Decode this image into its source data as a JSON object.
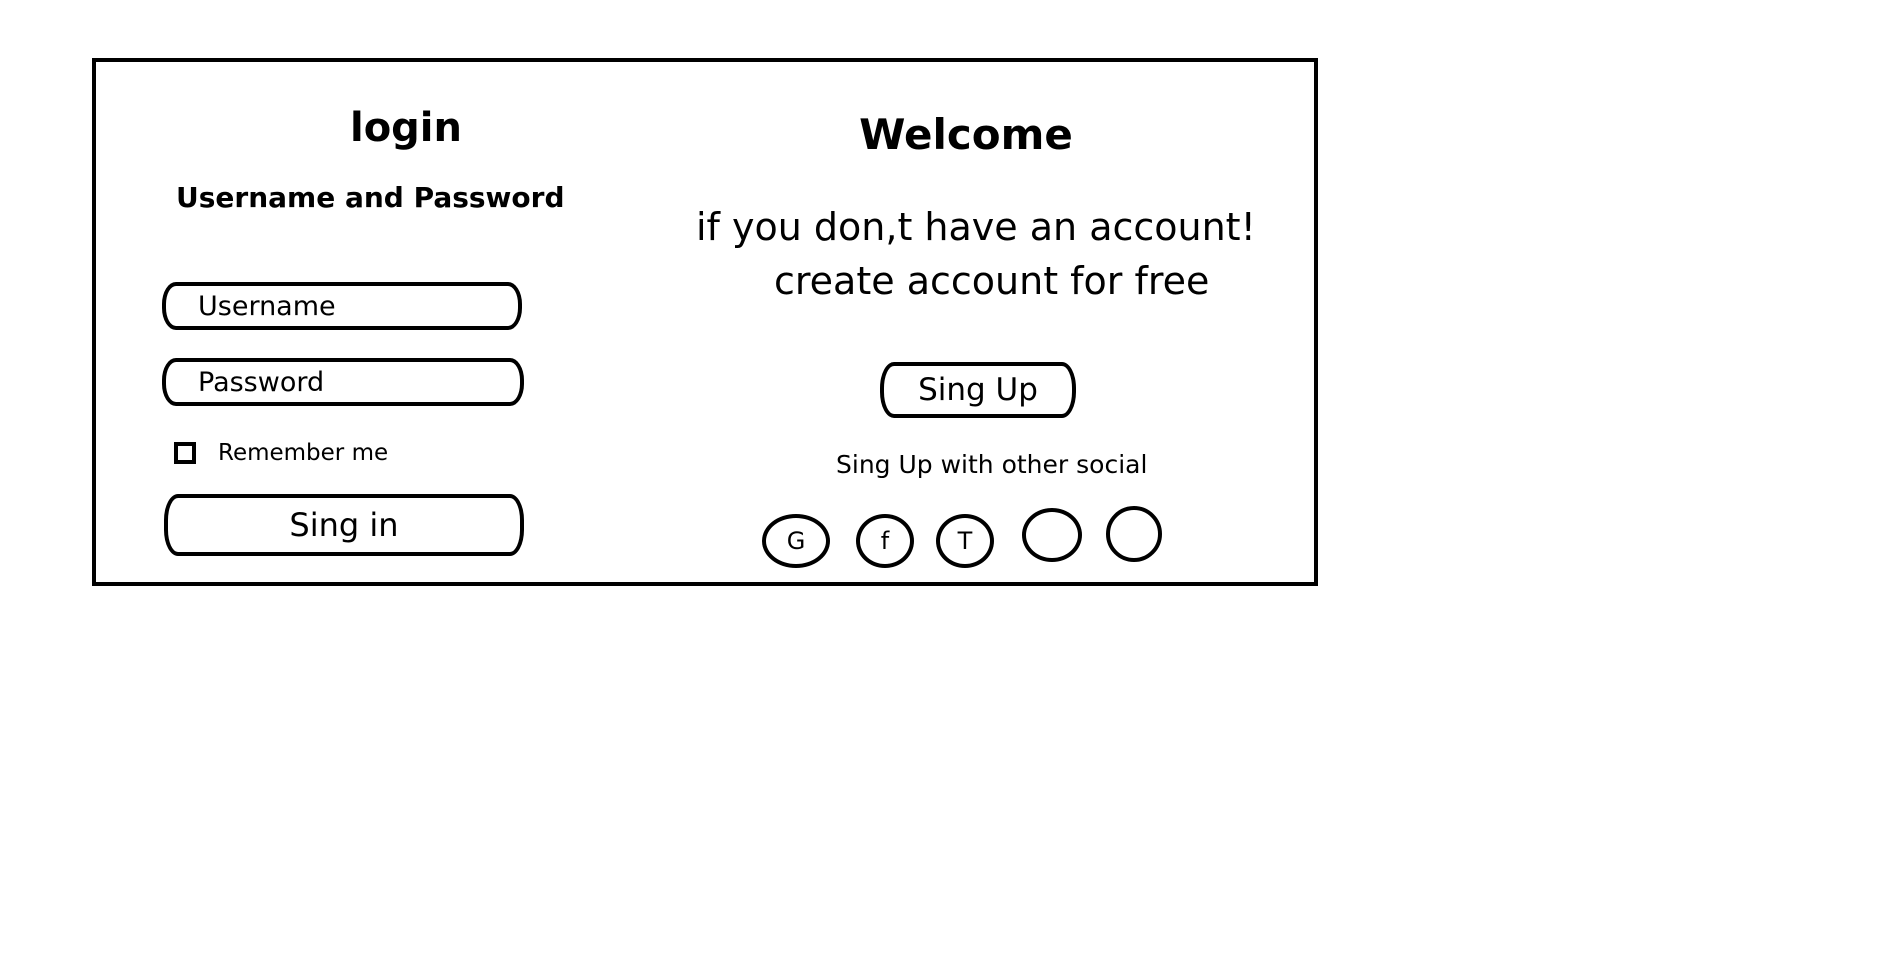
{
  "login": {
    "title": "login",
    "subtitle": "Username and Password",
    "username_placeholder": "Username",
    "password_placeholder": "Password",
    "remember_label": "Remember me",
    "remember_checked": false,
    "signin_label": "Sing in"
  },
  "welcome": {
    "title": "Welcome",
    "line1": "if you don,t have an account!",
    "line2": "create account for free",
    "signup_label": "Sing Up",
    "social_label": "Sing Up with other social",
    "social_buttons": [
      {
        "label": "G",
        "icon": "google-icon"
      },
      {
        "label": "f",
        "icon": "facebook-icon"
      },
      {
        "label": "T",
        "icon": "twitter-icon"
      },
      {
        "label": "",
        "icon": "social-icon"
      },
      {
        "label": "",
        "icon": "social-icon"
      }
    ]
  },
  "colors": {
    "stroke": "#000000",
    "background": "#ffffff"
  }
}
